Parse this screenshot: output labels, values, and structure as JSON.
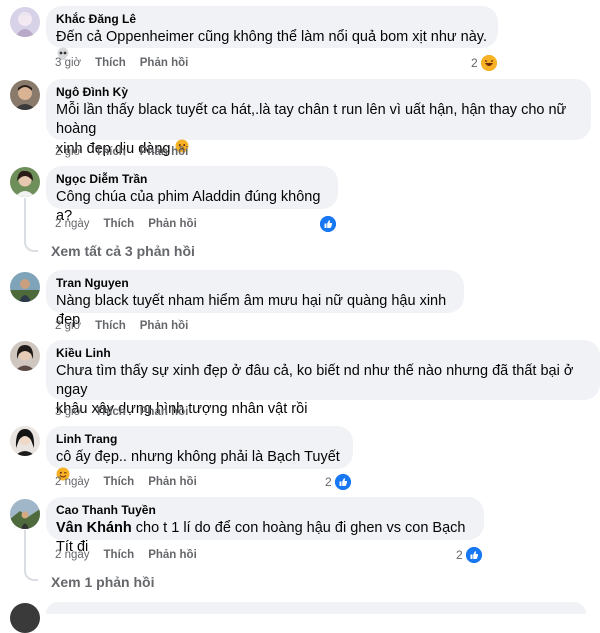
{
  "comments": [
    {
      "author": "Khắc Đăng Lê",
      "text": "Đến cả Oppenheimer cũng không thể làm nổi quả bom xịt như này.",
      "time": "3 giờ",
      "like": "Thích",
      "reply": "Phản hồi",
      "reactions": "2",
      "text_emoji": "skull-emoji",
      "reaction_icon": "haha-icon"
    },
    {
      "author": "Ngô Đình Kỳ",
      "text_line1": "Mỗi lần thấy black tuyết ca hát,.là tay chân t run lên vì uất hận, hận thay cho nữ hoàng",
      "text_line2": "xinh đẹp dịu dàng",
      "time": "2 giờ",
      "like": "Thích",
      "reply": "Phản hồi",
      "text_emoji": "sad-face-emoji"
    },
    {
      "author": "Ngọc Diễm Trần",
      "text": "Công chúa của phim Aladdin đúng không ạ?",
      "time": "2 ngày",
      "like": "Thích",
      "reply": "Phản hồi",
      "reactions": "",
      "reaction_icon": "like-icon",
      "view_replies": "Xem tất cả 3 phản hồi"
    },
    {
      "author": "Tran Nguyen",
      "text": "Nàng black tuyết nham hiểm âm mưu hại nữ quàng hậu xinh đẹp",
      "time": "2 giờ",
      "like": "Thích",
      "reply": "Phản hồi"
    },
    {
      "author": "Kiều Linh",
      "text_line1": "Chưa tìm thấy sự xinh đẹp ở đâu cả, ko biết nd như thế nào nhưng đã thất bại ở ngay",
      "text_line2": "khâu xây dựng hình tượng nhân vật rồi",
      "time": "3 giờ",
      "like": "Thích",
      "reply": "Phản hồi"
    },
    {
      "author": "Linh Trang",
      "text": "cô ấy đẹp.. nhưng không phải là Bạch Tuyết",
      "time": "2 ngày",
      "like": "Thích",
      "reply": "Phản hồi",
      "reactions": "2",
      "reaction_icon": "like-icon",
      "text_emoji": "wink-emoji"
    },
    {
      "author": "Cao Thanh Tuyền",
      "mention": "Vân Khánh",
      "text": " cho t 1 lí do để con hoàng hậu đi ghen vs con Bạch Tít đi",
      "time": "2 ngày",
      "like": "Thích",
      "reply": "Phản hồi",
      "reactions": "2",
      "reaction_icon": "like-icon",
      "view_replies": "Xem 1 phản hồi"
    }
  ],
  "colors": {
    "bubble": "#f0f2f5",
    "meta": "#65676b",
    "like_blue": "#1877f2",
    "haha_yellow": "#f7b125"
  }
}
